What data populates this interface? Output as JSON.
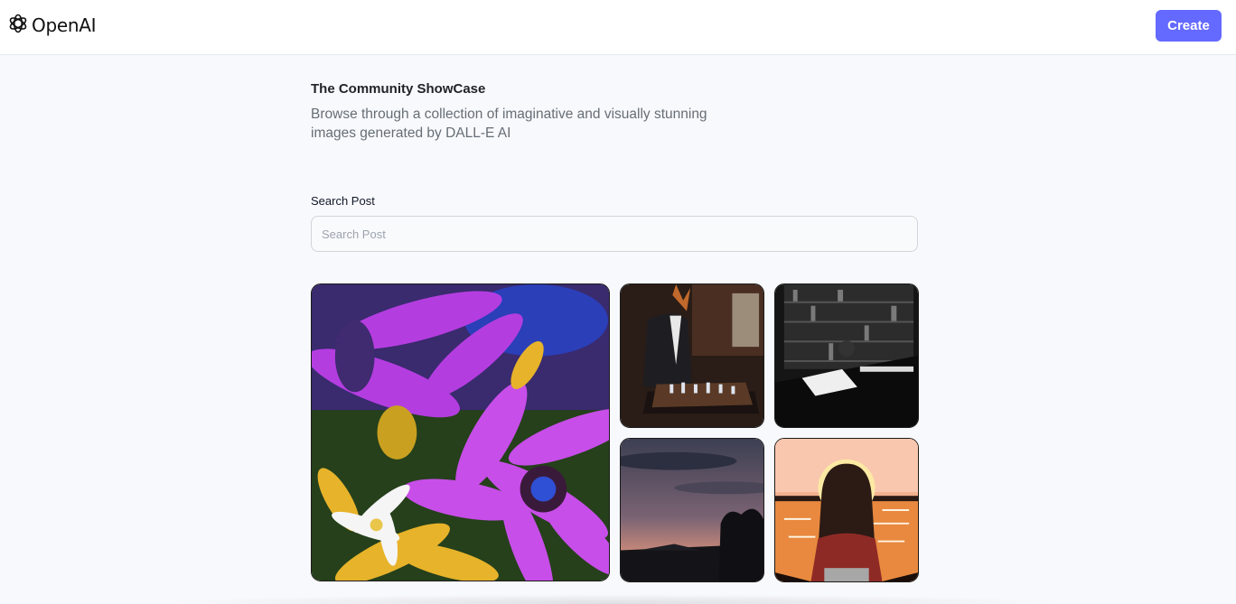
{
  "header": {
    "logo_text": "OpenAI",
    "logo_icon": "openai-logo-icon",
    "create_label": "Create",
    "accent_color": "#6469ff"
  },
  "hero": {
    "title": "The Community ShowCase",
    "subtitle": "Browse through a collection of imaginative and visually stunning images generated by DALL-E AI"
  },
  "search": {
    "label": "Search Post",
    "placeholder": "Search Post",
    "value": ""
  }
}
